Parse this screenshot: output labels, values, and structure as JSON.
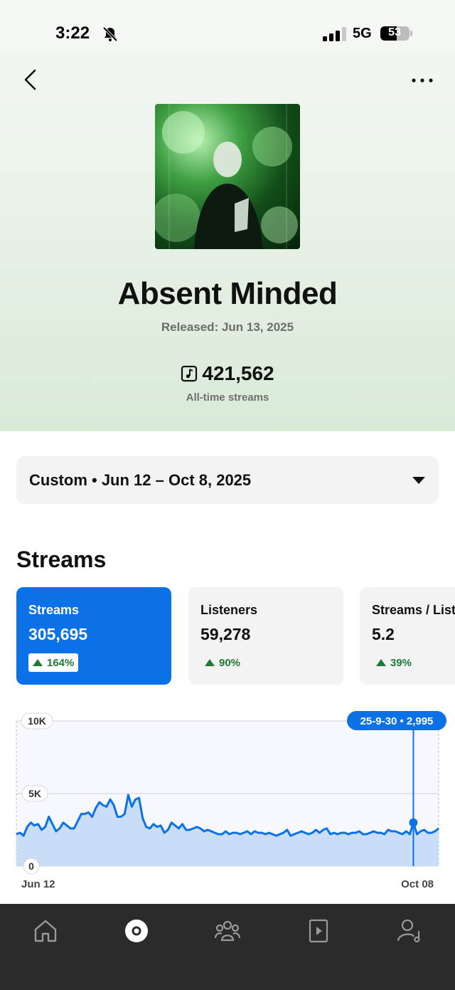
{
  "status_bar": {
    "time": "3:22",
    "network": "5G",
    "battery": "53"
  },
  "track": {
    "title": "Absent Minded",
    "released": "Released: Jun 13, 2025",
    "all_time_streams": "421,562",
    "all_time_label": "All-time streams"
  },
  "date_range": {
    "label": "Custom • Jun 12 – Oct 8, 2025"
  },
  "section": {
    "title": "Streams"
  },
  "cards": [
    {
      "label": "Streams",
      "value": "305,695",
      "change": "164%",
      "active": true
    },
    {
      "label": "Listeners",
      "value": "59,278",
      "change": "90%",
      "active": false
    },
    {
      "label": "Streams / Listener",
      "value": "5.2",
      "change": "39%",
      "active": false
    }
  ],
  "colors": {
    "accent": "#0a72e6",
    "positive": "#1f7a35",
    "tabbar": "#2b2b2c"
  },
  "chart_data": {
    "type": "area",
    "y_ticks": [
      "10K",
      "5K",
      "0"
    ],
    "ylim": [
      0,
      10000
    ],
    "x_start_label": "Jun 12",
    "x_end_label": "Oct 08",
    "tooltip": {
      "date": "25-9-30",
      "value": "2,995",
      "text": "25-9-30 • 2,995"
    },
    "highlight_index": 110,
    "values": [
      2200,
      2300,
      2100,
      2700,
      3000,
      2800,
      2900,
      2500,
      2700,
      3400,
      2900,
      2400,
      2600,
      3000,
      2800,
      2600,
      2600,
      3100,
      3600,
      3600,
      3700,
      3400,
      4000,
      4400,
      4200,
      4100,
      4600,
      4200,
      3400,
      3400,
      3600,
      4900,
      4100,
      4600,
      4700,
      3300,
      2700,
      2600,
      2900,
      2700,
      2800,
      2300,
      2500,
      3000,
      2800,
      2600,
      2900,
      2500,
      2500,
      2600,
      2700,
      2600,
      2400,
      2500,
      2400,
      2300,
      2200,
      2200,
      2400,
      2200,
      2300,
      2300,
      2200,
      2300,
      2400,
      2200,
      2400,
      2300,
      2300,
      2200,
      2300,
      2200,
      2100,
      2200,
      2300,
      2500,
      2100,
      2200,
      2300,
      2400,
      2300,
      2200,
      2300,
      2500,
      2300,
      2500,
      2600,
      2200,
      2300,
      2200,
      2300,
      2300,
      2200,
      2300,
      2300,
      2400,
      2200,
      2200,
      2300,
      2400,
      2300,
      2300,
      2200,
      2500,
      2400,
      2400,
      2300,
      2200,
      2400,
      2200,
      2995,
      2200,
      2400,
      2500,
      2300,
      2300,
      2400,
      2600
    ]
  }
}
